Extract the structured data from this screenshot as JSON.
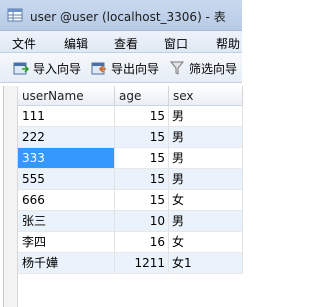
{
  "window": {
    "title": "user @user (localhost_3306) - 表",
    "icon": "table-icon"
  },
  "menu": [
    {
      "label": "文件"
    },
    {
      "label": "编辑"
    },
    {
      "label": "查看"
    },
    {
      "label": "窗口"
    },
    {
      "label": "帮助"
    }
  ],
  "toolbar": {
    "import_wizard": {
      "label": "导入向导",
      "icon": "import-icon"
    },
    "export_wizard": {
      "label": "导出向导",
      "icon": "export-icon"
    },
    "filter_wizard": {
      "label": "筛选向导",
      "icon": "filter-icon"
    }
  },
  "table": {
    "columns": [
      "userName",
      "age",
      "sex"
    ],
    "rows": [
      {
        "userName": "111",
        "age": "15",
        "sex": "男"
      },
      {
        "userName": "222",
        "age": "15",
        "sex": "男"
      },
      {
        "userName": "333",
        "age": "15",
        "sex": "男"
      },
      {
        "userName": "555",
        "age": "15",
        "sex": "男"
      },
      {
        "userName": "666",
        "age": "15",
        "sex": "女"
      },
      {
        "userName": "张三",
        "age": "10",
        "sex": "男"
      },
      {
        "userName": "李四",
        "age": "16",
        "sex": "女"
      },
      {
        "userName": "杨千嬅",
        "age": "1211",
        "sex": "女1"
      }
    ],
    "selected_row": 2
  },
  "colors": {
    "selection": "#3399ff",
    "alt_row": "#eaf2fb"
  }
}
